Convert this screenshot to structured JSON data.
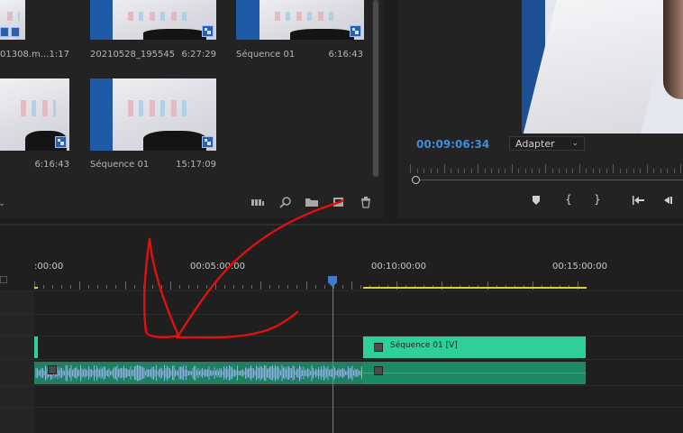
{
  "project_panel": {
    "clips": [
      {
        "name": "01308.m...",
        "duration": "1:17",
        "kind": "audio-video"
      },
      {
        "name": "20210528_195545",
        "duration": "6:27:29",
        "kind": "sequence"
      },
      {
        "name": "Séquence 01",
        "duration": "6:16:43",
        "kind": "sequence"
      },
      {
        "name": "",
        "duration": "6:16:43",
        "kind": "sequence"
      },
      {
        "name": "Séquence 01",
        "duration": "15:17:09",
        "kind": "sequence"
      }
    ],
    "tools": [
      "storyboard-icon",
      "search-icon",
      "folder-icon",
      "new-item-icon",
      "trash-icon"
    ]
  },
  "program_monitor": {
    "timecode": "00:09:06:34",
    "fit": "Adapter",
    "controls": [
      "marker-icon",
      "mark-in-icon",
      "mark-out-icon",
      "go-to-in-icon",
      "step-back-icon"
    ]
  },
  "timeline": {
    "ruler_labels": [
      ":00:00",
      "00:05:00:00",
      "00:10:00:00",
      "00:15:00:00"
    ],
    "video_clip_label": "Séquence 01 [V]",
    "colors": {
      "playhead": "#3f8ce0",
      "video_clip": "#2ecf98",
      "audio_clip": "#1f7f60",
      "work_area": "#d9d23a",
      "annotation": "#e01010"
    }
  }
}
